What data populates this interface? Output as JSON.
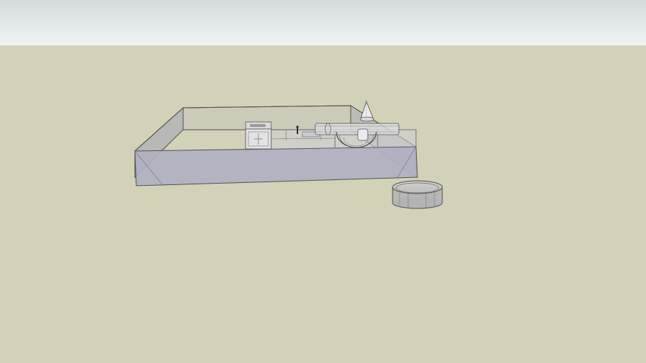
{
  "scene": {
    "colors": {
      "sky_top": "#d4dcdf",
      "sky_bottom": "#f0f3f3",
      "ground": "#d3d1b7",
      "box_front": "#b4b4c3",
      "box_side": "#a6a6b6",
      "box_top": "#c6c5ba",
      "edge": "#4f4f4f",
      "ring": "#9e9ea4"
    },
    "objects": [
      {
        "name": "base-box",
        "icon": "box-icon"
      },
      {
        "name": "small-cabinet",
        "icon": "cabinet-icon"
      },
      {
        "name": "cone",
        "icon": "cone-icon"
      },
      {
        "name": "cylinder-pipe",
        "icon": "pipe-icon"
      },
      {
        "name": "ring",
        "icon": "ring-icon"
      }
    ]
  }
}
